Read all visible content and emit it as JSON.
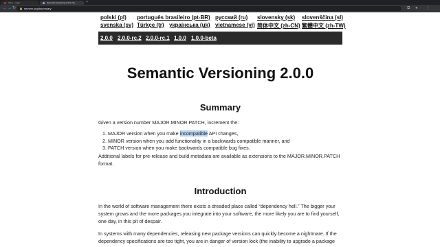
{
  "browser": {
    "tabs": [
      {
        "title": "Inbox – login",
        "active": false
      },
      {
        "title": "Semantic Versioning 2.0.0 | Se...",
        "active": true
      }
    ],
    "url": "semver.org/#summary"
  },
  "languages": {
    "row1": [
      "polski (pl)",
      "português brasileiro (pt-BR)",
      "русский (ru)",
      "slovensky (sk)",
      "slovenščina (sl)"
    ],
    "row2": [
      "svenska (sv)",
      "Türkçe (tr)",
      "українська (uk)",
      "vietnamese (vi)",
      "简体中文 (zh-CN)",
      "繁體中文 (zh-TW)"
    ]
  },
  "versions": [
    "2.0.0",
    "2.0.0-rc.2",
    "2.0.0-rc.1",
    "1.0.0",
    "1.0.0-beta"
  ],
  "title": "Semantic Versioning 2.0.0",
  "summary": {
    "heading": "Summary",
    "intro": "Given a version number MAJOR.MINOR.PATCH, increment the:",
    "item1_before": "1. MAJOR version when you make ",
    "item1_highlight": "incompatible",
    "item1_after": " API changes,",
    "item2": "2. MINOR version when you add functionality in a backwards compatible manner, and",
    "item3": "3. PATCH version when you make backwards compatible bug fixes.",
    "extra": "Additional labels for pre-release and build metadata are available as extensions to the MAJOR.MINOR.PATCH format."
  },
  "introduction": {
    "heading": "Introduction",
    "p1": "In the world of software management there exists a dreaded place called “dependency hell.” The bigger your system grows and the more packages you integrate into your software, the more likely you are to find yourself, one day, in this pit of despair.",
    "p2": "In systems with many dependencies, releasing new package versions can quickly become a nightmare. If the dependency specifications are too tight, you are in danger of version lock (the inability to upgrade a package"
  },
  "colors": {
    "version_bar": "#2b2b2b",
    "selection": "#b7d3f5"
  }
}
